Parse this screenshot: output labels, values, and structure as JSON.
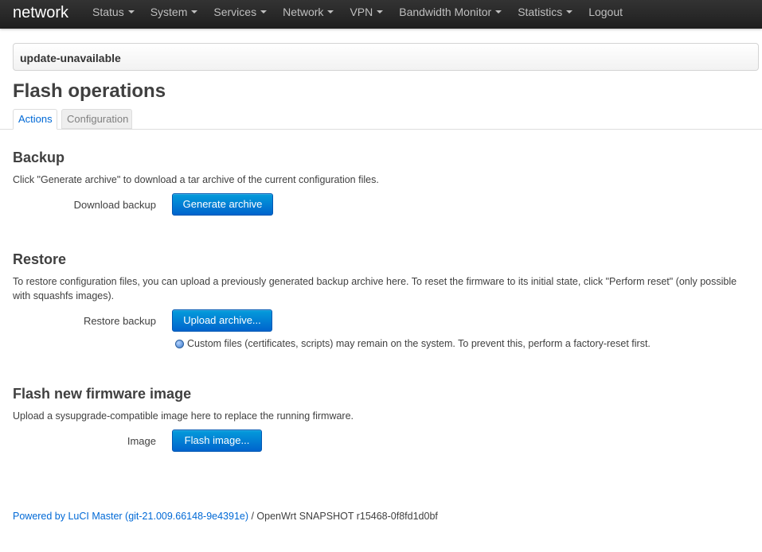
{
  "navbar": {
    "brand": "network",
    "menu": [
      {
        "label": "Status",
        "dropdown": true
      },
      {
        "label": "System",
        "dropdown": true
      },
      {
        "label": "Services",
        "dropdown": true
      },
      {
        "label": "Network",
        "dropdown": true
      },
      {
        "label": "VPN",
        "dropdown": true
      },
      {
        "label": "Bandwidth Monitor",
        "dropdown": true
      },
      {
        "label": "Statistics",
        "dropdown": true
      },
      {
        "label": "Logout",
        "dropdown": false
      }
    ]
  },
  "hostbar": {
    "text": "update-unavailable"
  },
  "page": {
    "title": "Flash operations"
  },
  "tabs": [
    {
      "label": "Actions",
      "active": true
    },
    {
      "label": "Configuration",
      "active": false
    }
  ],
  "backup": {
    "heading": "Backup",
    "description": "Click \"Generate archive\" to download a tar archive of the current configuration files.",
    "label": "Download backup",
    "button": "Generate archive"
  },
  "restore": {
    "heading": "Restore",
    "description": "To restore configuration files, you can upload a previously generated backup archive here. To reset the firmware to its initial state, click \"Perform reset\" (only possible with squashfs images).",
    "label": "Restore backup",
    "button": "Upload archive...",
    "note": "Custom files (certificates, scripts) may remain on the system. To prevent this, perform a factory-reset first."
  },
  "flash": {
    "heading": "Flash new firmware image",
    "description": "Upload a sysupgrade-compatible image here to replace the running firmware.",
    "label": "Image",
    "button": "Flash image..."
  },
  "footer": {
    "link": "Powered by LuCI Master (git-21.009.66148-9e4391e)",
    "text": " / OpenWrt SNAPSHOT r15468-0f8fd1d0bf"
  },
  "colors": {
    "navbar": "#222222",
    "link": "#0069d6",
    "button": "#0064cd"
  }
}
